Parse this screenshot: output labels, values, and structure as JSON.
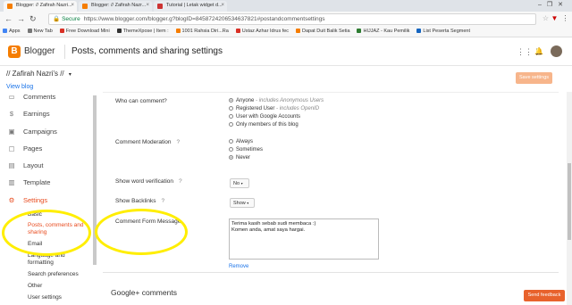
{
  "browser": {
    "tabs": [
      {
        "title": "Blogger: // Zafirah Nazri..."
      },
      {
        "title": "Blogger: // Zafirah Nazr..."
      },
      {
        "title": "Tutorial | Letak widget d..."
      }
    ],
    "url": "https://www.blogger.com/blogger.g?blogID=8458724206534637821#postandcommentsettings",
    "secure_label": "Secure",
    "bookmarks": [
      "Apps",
      "New Tab",
      "Free Download Mini",
      "ThemeXpose | Item :",
      "1001 Rahsia Diri...Ra",
      "Ustaz Azhar Idrus fec",
      "Dapat Duit Balik Setia",
      "HIJJAZ - Kau Pemilik",
      "List Peserta Segment"
    ]
  },
  "header": {
    "brand": "Blogger",
    "page_title": "Posts, comments and sharing settings"
  },
  "blog": {
    "name": "// Zafirah Nazri's //",
    "view_blog": "View blog",
    "save_settings": "Save settings"
  },
  "sidebar": {
    "items": [
      {
        "label": "Comments",
        "icon": "comment-icon"
      },
      {
        "label": "Earnings",
        "icon": "dollar-icon"
      },
      {
        "label": "Campaigns",
        "icon": "campaign-icon"
      },
      {
        "label": "Pages",
        "icon": "pages-icon"
      },
      {
        "label": "Layout",
        "icon": "layout-icon"
      },
      {
        "label": "Template",
        "icon": "template-icon"
      },
      {
        "label": "Settings",
        "icon": "gear-icon"
      }
    ],
    "sub_items": [
      {
        "label": "Basic"
      },
      {
        "label": "Posts, comments and sharing"
      },
      {
        "label": "Email"
      },
      {
        "label": "Language and formatting"
      },
      {
        "label": "Search preferences"
      },
      {
        "label": "Other"
      },
      {
        "label": "User settings"
      }
    ]
  },
  "settings": {
    "who_can_comment": {
      "label": "Who can comment?",
      "options": [
        {
          "label": "Anyone",
          "note": "- includes Anonymous Users"
        },
        {
          "label": "Registered User",
          "note": "- includes OpenID"
        },
        {
          "label": "User with Google Accounts",
          "note": ""
        },
        {
          "label": "Only members of this blog",
          "note": ""
        }
      ]
    },
    "comment_moderation": {
      "label": "Comment Moderation",
      "options": [
        {
          "label": "Always"
        },
        {
          "label": "Sometimes"
        },
        {
          "label": "Never"
        }
      ]
    },
    "word_verification": {
      "label": "Show word verification",
      "value": "No"
    },
    "backlinks": {
      "label": "Show Backlinks",
      "value": "Show"
    },
    "comment_form": {
      "label": "Comment Form Message",
      "text": "Terima kasih sebab sudi membaca :)\nKomen anda, amat saya hargai.",
      "remove": "Remove"
    },
    "gplus_heading": "Google+ comments",
    "help": "?"
  },
  "feedback_button": "Send feedback",
  "colors": {
    "accent": "#e84a1d",
    "brand": "#f57d00",
    "highlight": "#ffee00"
  }
}
